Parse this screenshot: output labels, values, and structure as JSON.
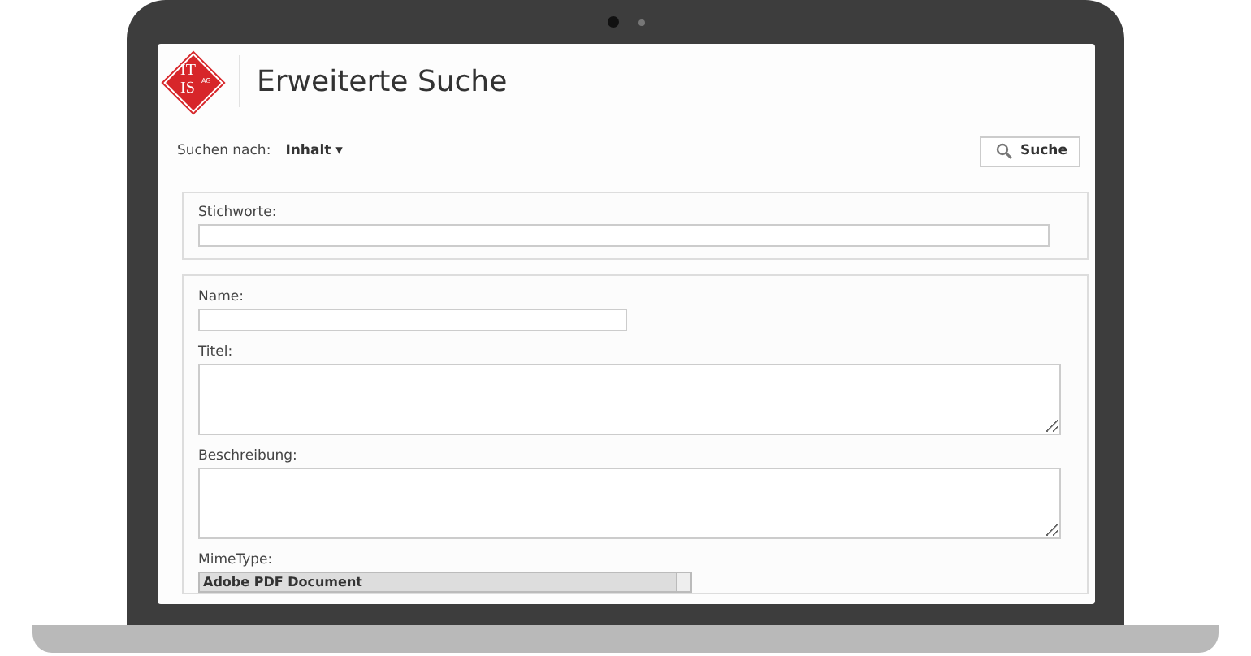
{
  "logo": {
    "line_1": "IT",
    "line_2": "IS",
    "suffix": "AG"
  },
  "header": {
    "title": "Erweiterte Suche"
  },
  "search_by": {
    "label": "Suchen nach:",
    "value": "Inhalt ▾"
  },
  "search_button": {
    "label": "Suche"
  },
  "keywords": {
    "label": "Stichworte:"
  },
  "fields": [
    {
      "kind": "input",
      "label": "Name:"
    },
    {
      "kind": "textarea",
      "label": "Titel:"
    },
    {
      "kind": "textarea",
      "label": "Beschreibung:"
    },
    {
      "kind": "select",
      "label": "MimeType:",
      "value": "Adobe PDF Document"
    }
  ]
}
